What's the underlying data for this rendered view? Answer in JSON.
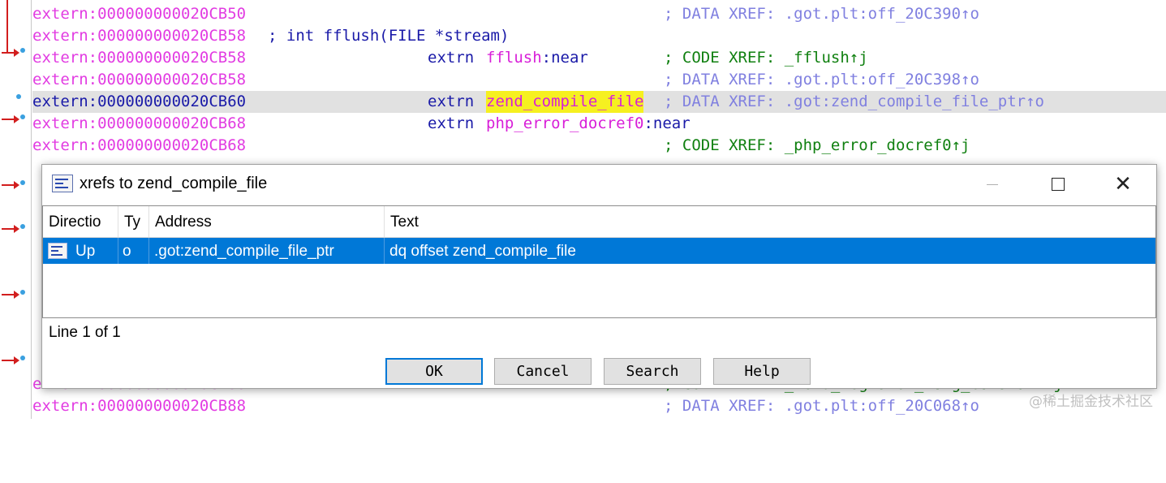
{
  "listing": [
    {
      "addr": "extern:000000000020CB50",
      "comment": "; DATA XREF: .got.plt:off_20C390↑o",
      "comment_kind": "data"
    },
    {
      "addr": "extern:000000000020CB58",
      "proto": "; int fflush(FILE *stream)"
    },
    {
      "addr": "extern:000000000020CB58",
      "mnem": "extrn",
      "sym": "fflush",
      "suffix": ":near",
      "comment": "; CODE XREF: _fflush↑j",
      "comment_kind": "code"
    },
    {
      "addr": "extern:000000000020CB58",
      "comment": "; DATA XREF: .got.plt:off_20C398↑o",
      "comment_kind": "data"
    },
    {
      "addr": "extern:000000000020CB60",
      "mnem": "extrn",
      "sym": "zend_compile_file",
      "highlight": true,
      "comment": "; DATA XREF: .got:zend_compile_file_ptr↑o",
      "comment_kind": "data"
    },
    {
      "addr": "extern:000000000020CB68",
      "mnem": "extrn",
      "sym": "php_error_docref0",
      "suffix": ":near"
    },
    {
      "addr": "extern:000000000020CB68",
      "comment": "; CODE XREF: _php_error_docref0↑j",
      "comment_kind": "code"
    },
    {
      "addr": "extern:000000000020CB88",
      "comment": "; CODE XREF: _zend_register_long_constant↑j",
      "comment_kind": "code"
    },
    {
      "addr": "extern:000000000020CB88",
      "comment": "; DATA XREF: .got.plt:off_20C068↑o",
      "comment_kind": "data"
    }
  ],
  "dialog": {
    "title": "xrefs to zend_compile_file",
    "columns": [
      "Directio",
      "Ty",
      "Address",
      "Text"
    ],
    "row": {
      "direction": "Up",
      "type": "o",
      "address": ".got:zend_compile_file_ptr",
      "text": "dq offset zend_compile_file"
    },
    "status": "Line 1 of 1",
    "buttons": {
      "ok": "OK",
      "cancel": "Cancel",
      "search": "Search",
      "help": "Help"
    }
  },
  "watermark": "@稀土掘金技术社区",
  "colors": {
    "selection": "#0078d7",
    "address": "#e23ce2",
    "mnemonic": "#1a1aa8",
    "code_comment": "#108010",
    "data_comment": "#8080e0",
    "highlight": "#f6f020"
  }
}
